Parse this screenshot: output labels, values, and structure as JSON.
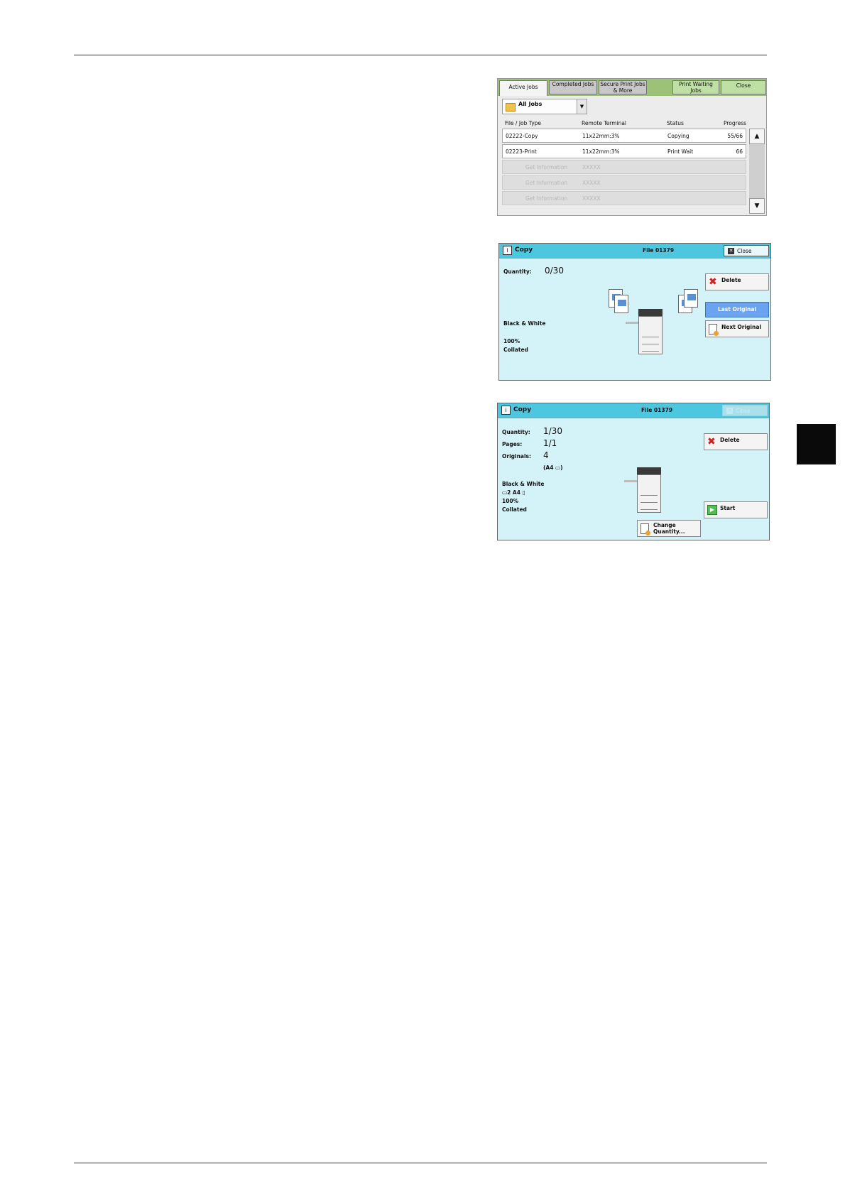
{
  "job_list": {
    "tabs": [
      "Active Jobs",
      "Completed Jobs",
      "Secure Print Jobs & More",
      "Print Waiting Jobs",
      "Close"
    ],
    "filter": "All Jobs",
    "columns": [
      "File / Job Type",
      "Remote Terminal",
      "Status",
      "Progress"
    ],
    "rows": [
      {
        "file": "02222-Copy",
        "terminal": "11x22mm:3%",
        "status": "Copying",
        "progress": "55/66"
      },
      {
        "file": "02223-Print",
        "terminal": "11x22mm:3%",
        "status": "Print Wait",
        "progress": "66"
      }
    ],
    "ghost_rows": [
      {
        "file": "Get Information",
        "terminal": "XXXXX"
      },
      {
        "file": "Get Information",
        "terminal": "XXXXX"
      },
      {
        "file": "Get Information",
        "terminal": "XXXXX"
      }
    ],
    "scroll_up": "▲",
    "scroll_down": "▼"
  },
  "copy_dialog_1": {
    "title": "Copy",
    "file": "File 01379",
    "close": "Close",
    "quantity_label": "Quantity:",
    "quantity_value": "0/30",
    "color_mode": "Black & White",
    "scale": "100%",
    "output": "Collated",
    "delete": "Delete",
    "last_original": "Last Original",
    "next_original": "Next Original"
  },
  "copy_dialog_2": {
    "title": "Copy",
    "file": "File 01379",
    "close": "Close",
    "quantity_label": "Quantity:",
    "quantity_value": "1/30",
    "pages_label": "Pages:",
    "pages_value": "1/1",
    "originals_label": "Originals:",
    "originals_value": "4",
    "originals_size": "(A4 ▭)",
    "color_mode": "Black & White",
    "tray": "▭2  A4 ▯",
    "scale": "100%",
    "output": "Collated",
    "delete": "Delete",
    "start": "Start",
    "change_quantity_1": "Change",
    "change_quantity_2": "Quantity..."
  }
}
